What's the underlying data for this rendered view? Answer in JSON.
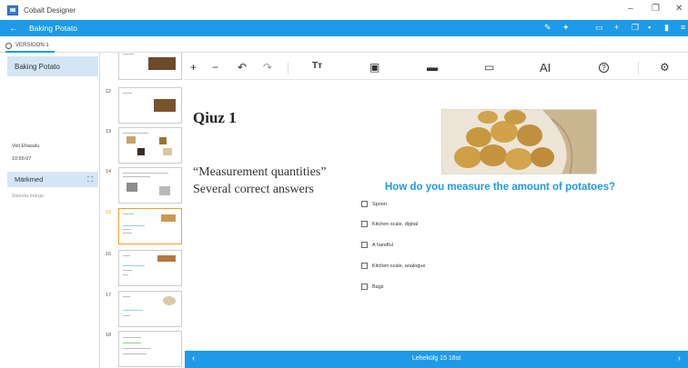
{
  "window": {
    "app_title": "Cobalt Designer",
    "minimize": "–",
    "maximize": "❐",
    "close": "✕"
  },
  "header": {
    "back_icon": "←",
    "doc_title": "Baking Potato",
    "icons": [
      "brush-icon",
      "pin-icon",
      "monitor-icon",
      "plus-icon",
      "copy-icon",
      "save-icon",
      "delete-icon",
      "more-icon"
    ]
  },
  "version_tab": {
    "label": "VERSIOON 1"
  },
  "left_panel": {
    "lesson_title": "Baking Potato",
    "author": "Veli Ehasalu",
    "time": "10:55:07",
    "notes_title": "Märkmed",
    "notes_placeholder": "Sisesta märge"
  },
  "thumbnails": [
    {
      "number": "",
      "title": ""
    },
    {
      "number": "12",
      "title": ""
    },
    {
      "number": "13",
      "title": ""
    },
    {
      "number": "14",
      "title": ""
    },
    {
      "number": "15",
      "title": ""
    },
    {
      "number": "16",
      "title": ""
    },
    {
      "number": "17",
      "title": ""
    },
    {
      "number": "18",
      "title": ""
    }
  ],
  "toolbar": {
    "add": "+",
    "remove": "−",
    "undo": "↶",
    "redo": "↷",
    "text": "Tт",
    "image": "▣",
    "video": "▬",
    "layout": "▭",
    "font_size": "AI",
    "help": "?",
    "settings": "⚙"
  },
  "slide": {
    "title": "Qiuz 1",
    "subtitle_line1": "“Measurement quantities”",
    "subtitle_line2": "Several correct answers",
    "question": "How do you measure the amount of potatoes?",
    "options": [
      "Spoon",
      "Kitchen scale, digital",
      "A handful",
      "Kitchen scale, analogue",
      "Bags"
    ]
  },
  "footer": {
    "prev": "‹",
    "next": "›",
    "pager": "Lehekülg 15 18st"
  },
  "colors": {
    "accent": "#1e9ae8",
    "panel_header": "#d4e6f5",
    "active_thumb_border": "#f0a020"
  }
}
